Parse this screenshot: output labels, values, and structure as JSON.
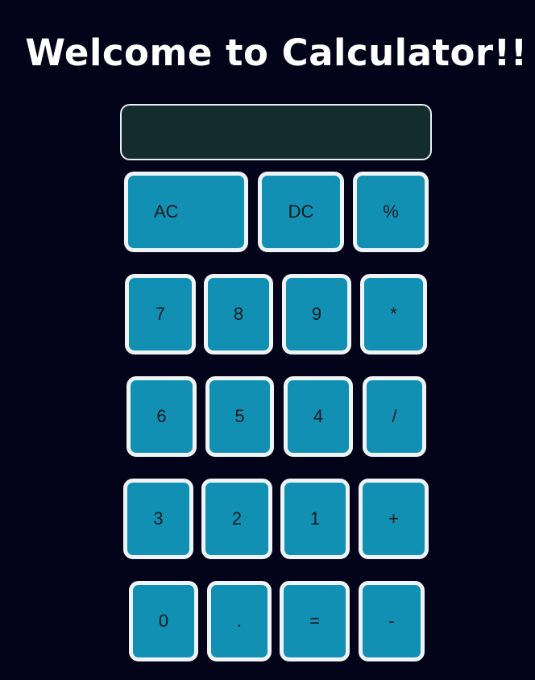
{
  "header": {
    "title": "Welcome to Calculator!!"
  },
  "display": {
    "value": ""
  },
  "keys": {
    "ac": "AC",
    "dc": "DC",
    "percent": "%",
    "seven": "7",
    "eight": "8",
    "nine": "9",
    "multiply": "*",
    "six": "6",
    "five": "5",
    "four": "4",
    "divide": "/",
    "three": "3",
    "two": "2",
    "one": "1",
    "plus": "+",
    "zero": "0",
    "dot": ".",
    "equals": "=",
    "minus": "-"
  },
  "colors": {
    "background": "#03031a",
    "display_bg": "#132c2e",
    "key_bg": "#1190b4",
    "key_border": "#eef3f6",
    "title": "#ffffff"
  }
}
